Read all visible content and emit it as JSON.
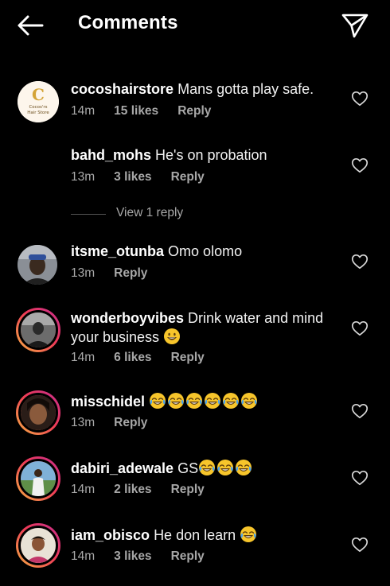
{
  "header": {
    "title": "Comments"
  },
  "comments": [
    {
      "user": "cocoshairstore",
      "text": "Mans gotta play safe.",
      "time": "14m",
      "likes": "15 likes",
      "reply": "Reply"
    },
    {
      "user": "bahd_mohs",
      "text": "He's on probation",
      "time": "13m",
      "likes": "3 likes",
      "reply": "Reply"
    },
    {
      "user": "itsme_otunba",
      "text": "Omo olomo",
      "time": "13m",
      "likes": "",
      "reply": "Reply"
    },
    {
      "user": "wonderboyvibes",
      "text": "Drink water and mind your business",
      "time": "14m",
      "likes": "6 likes",
      "reply": "Reply"
    },
    {
      "user": "misschidel",
      "text": "",
      "time": "13m",
      "likes": "",
      "reply": "Reply"
    },
    {
      "user": "dabiri_adewale",
      "text": "GS",
      "time": "14m",
      "likes": "2 likes",
      "reply": "Reply"
    },
    {
      "user": "iam_obisco",
      "text": "He don learn",
      "time": "14m",
      "likes": "3 likes",
      "reply": "Reply"
    }
  ],
  "view_replies": "View 1 reply",
  "avatar_logo": {
    "letter": "C",
    "line1": "Cocos'rs",
    "line2": "Hair Store"
  },
  "colors": {
    "background": "#000000",
    "muted": "#a8a8a8",
    "ring_start": "#f6b042",
    "ring_end": "#c42d8f"
  },
  "icons": [
    "back-arrow-icon",
    "send-icon",
    "heart-icon",
    "tears-of-joy-emoji",
    "grinning-emoji"
  ]
}
